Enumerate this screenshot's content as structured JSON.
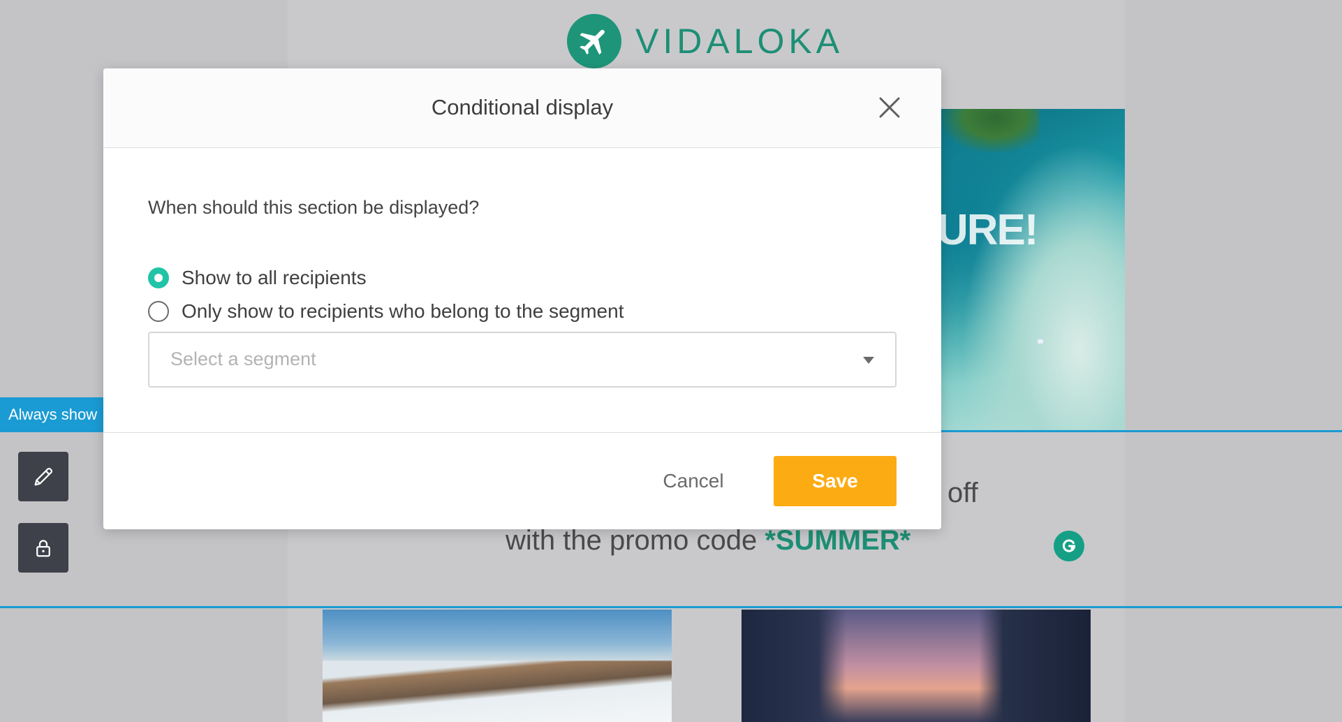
{
  "brand": {
    "name": "VIDALOKA"
  },
  "hero": {
    "text": "URE!"
  },
  "section_tag": {
    "label": "Always show"
  },
  "promo": {
    "off_text": "off",
    "line_prefix": "with the promo code ",
    "code": "*SUMMER*"
  },
  "toolbar": {
    "edit_icon": "pencil-icon",
    "lock_icon": "lock-icon"
  },
  "modal": {
    "title": "Conditional display",
    "question": "When should this section be displayed?",
    "options": [
      {
        "label": "Show to all recipients",
        "checked": true
      },
      {
        "label": "Only show to recipients who belong to the segment",
        "checked": false
      }
    ],
    "segment_select": {
      "placeholder": "Select a segment",
      "value": ""
    },
    "cancel_label": "Cancel",
    "save_label": "Save"
  },
  "colors": {
    "accent": "#21c4a6",
    "save_button": "#fdab13",
    "brand": "#1d8f75",
    "section_line": "#1b9bd3"
  }
}
